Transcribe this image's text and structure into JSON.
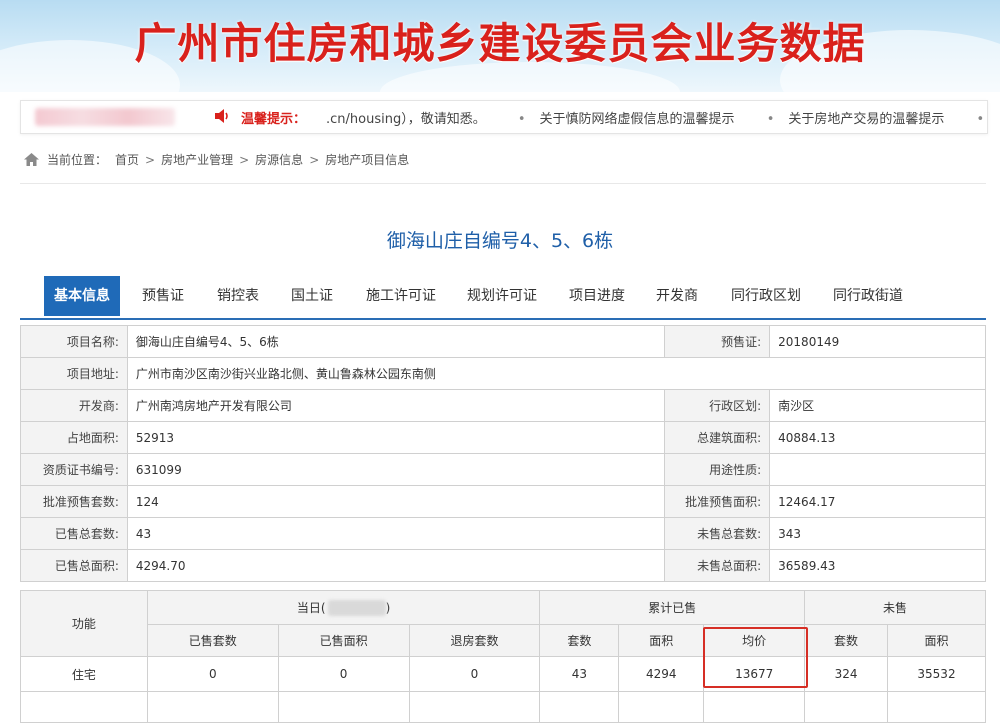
{
  "banner": {
    "title": "广州市住房和城乡建设委员会业务数据"
  },
  "notice": {
    "label": "温馨提示：",
    "items": [
      ".cn/housing），敬请知悉。",
      "关于慎防网络虚假信息的温馨提示",
      "关于房地产交易的温馨提示",
      "关于"
    ]
  },
  "breadcrumb": {
    "prefix": "当前位置：",
    "items": [
      "首页",
      "房地产业管理",
      "房源信息",
      "房地产项目信息"
    ]
  },
  "project": {
    "title": "御海山庄自编号4、5、6栋"
  },
  "tabs": [
    "基本信息",
    "预售证",
    "销控表",
    "国土证",
    "施工许可证",
    "规划许可证",
    "项目进度",
    "开发商",
    "同行政区划",
    "同行政街道"
  ],
  "info": {
    "project_name_label": "项目名称:",
    "project_name": "御海山庄自编号4、5、6栋",
    "presale_label": "预售证:",
    "presale": "20180149",
    "address_label": "项目地址:",
    "address": "广州市南沙区南沙街兴业路北侧、黄山鲁森林公园东南侧",
    "developer_label": "开发商:",
    "developer": "广州南鸿房地产开发有限公司",
    "district_label": "行政区划:",
    "district": "南沙区",
    "land_area_label": "占地面积:",
    "land_area": "52913",
    "total_build_area_label": "总建筑面积:",
    "total_build_area": "40884.13",
    "cert_no_label": "资质证书编号:",
    "cert_no": "631099",
    "usage_label": "用途性质:",
    "usage": "",
    "approved_units_label": "批准预售套数:",
    "approved_units": "124",
    "approved_area_label": "批准预售面积:",
    "approved_area": "12464.17",
    "sold_units_label": "已售总套数:",
    "sold_units": "43",
    "unsold_units_label": "未售总套数:",
    "unsold_units": "343",
    "sold_area_label": "已售总面积:",
    "sold_area": "4294.70",
    "unsold_area_label": "未售总面积:",
    "unsold_area": "36589.43"
  },
  "stats": {
    "function_label": "功能",
    "today_label": "当日(",
    "today_close": ")",
    "cumulative_label": "累计已售",
    "unsold_label": "未售",
    "cols": {
      "sold_units": "已售套数",
      "sold_area": "已售面积",
      "returned_units": "退房套数",
      "units": "套数",
      "area": "面积",
      "avg_price": "均价",
      "unsold_units": "套数",
      "unsold_area": "面积"
    },
    "row": {
      "type": "住宅",
      "today_sold_units": "0",
      "today_sold_area": "0",
      "today_returned": "0",
      "cum_units": "43",
      "cum_area": "4294",
      "cum_avg_price": "13677",
      "unsold_units": "324",
      "unsold_area": "35532"
    }
  }
}
